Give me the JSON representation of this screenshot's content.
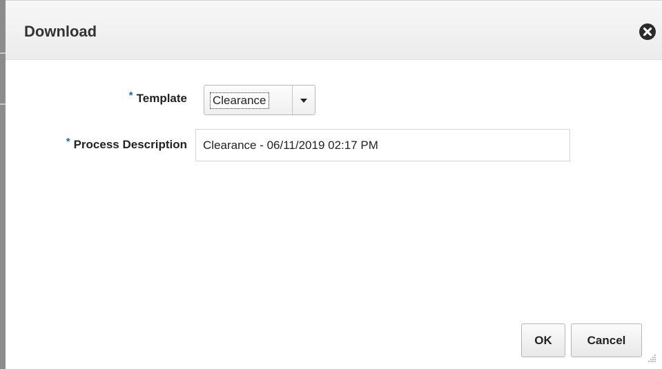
{
  "dialog": {
    "title": "Download"
  },
  "form": {
    "template": {
      "required_mark": "*",
      "label": "Template",
      "selected_value": "Clearance"
    },
    "process_description": {
      "required_mark": "*",
      "label": "Process Description",
      "value": "Clearance - 06/11/2019 02:17 PM"
    }
  },
  "buttons": {
    "ok_label": "OK",
    "cancel_label": "Cancel"
  },
  "icons": {
    "close": "close-circle-x-icon",
    "dropdown": "chevron-down-icon",
    "resize": "resize-grip-icon"
  },
  "colors": {
    "required_mark": "#0b6cc4",
    "title_text": "#333333",
    "titlebar_bg": "#efefef"
  }
}
